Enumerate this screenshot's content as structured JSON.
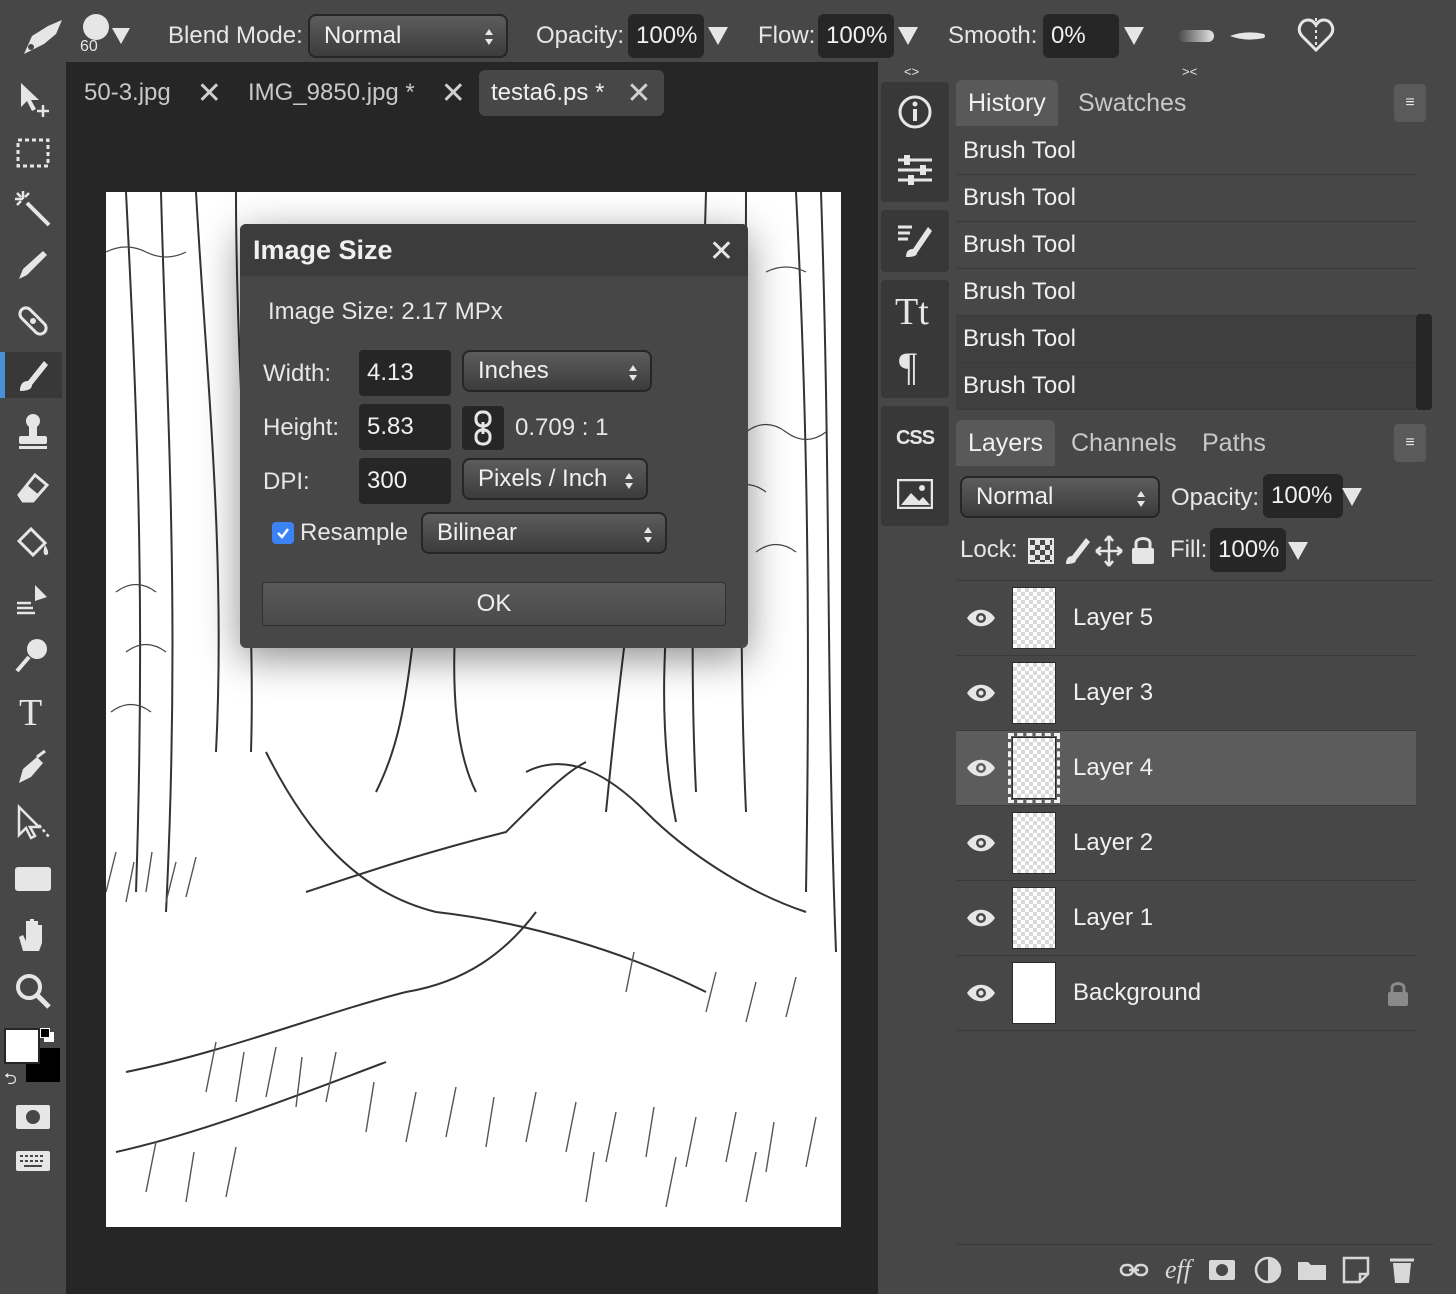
{
  "options_bar": {
    "brush_size": "60",
    "blend_mode_label": "Blend Mode:",
    "blend_mode_value": "Normal",
    "opacity_label": "Opacity:",
    "opacity_value": "100%",
    "flow_label": "Flow:",
    "flow_value": "100%",
    "smooth_label": "Smooth:",
    "smooth_value": "0%"
  },
  "tabs": [
    {
      "label": "50-3.jpg"
    },
    {
      "label": "IMG_9850.jpg *"
    },
    {
      "label": "testa6.ps *"
    }
  ],
  "dialog": {
    "title": "Image Size",
    "info": "Image Size: 2.17 MPx",
    "width_label": "Width:",
    "width_value": "4.13",
    "width_unit": "Inches",
    "height_label": "Height:",
    "height_value": "5.83",
    "ratio": "0.709 : 1",
    "dpi_label": "DPI:",
    "dpi_value": "300",
    "dpi_unit": "Pixels / Inch",
    "resample_label": "Resample",
    "resample_checked": true,
    "resample_method": "Bilinear",
    "ok_label": "OK"
  },
  "history_panel": {
    "tabs": [
      "History",
      "Swatches"
    ],
    "items": [
      "Brush Tool",
      "Brush Tool",
      "Brush Tool",
      "Brush Tool",
      "Brush Tool",
      "Brush Tool"
    ]
  },
  "layers_panel": {
    "tabs": [
      "Layers",
      "Channels",
      "Paths"
    ],
    "blend_mode": "Normal",
    "opacity_label": "Opacity:",
    "opacity_value": "100%",
    "lock_label": "Lock:",
    "fill_label": "Fill:",
    "fill_value": "100%",
    "layers": [
      {
        "name": "Layer 5",
        "visible": true,
        "active": false
      },
      {
        "name": "Layer 3",
        "visible": true,
        "active": false
      },
      {
        "name": "Layer 4",
        "visible": true,
        "active": true
      },
      {
        "name": "Layer 2",
        "visible": true,
        "active": false
      },
      {
        "name": "Layer 1",
        "visible": true,
        "active": false
      },
      {
        "name": "Background",
        "visible": true,
        "active": false,
        "locked": true
      }
    ]
  },
  "mid_column": {
    "collapse_left": "<>",
    "collapse_right": "><",
    "css_label": "CSS"
  },
  "bottom_bar": {
    "effects_label": "eff"
  },
  "colors": {
    "accent": "#4a90d9",
    "panel_bg": "#474747",
    "dark_bg": "#262626",
    "checkbox": "#3b82f6"
  }
}
